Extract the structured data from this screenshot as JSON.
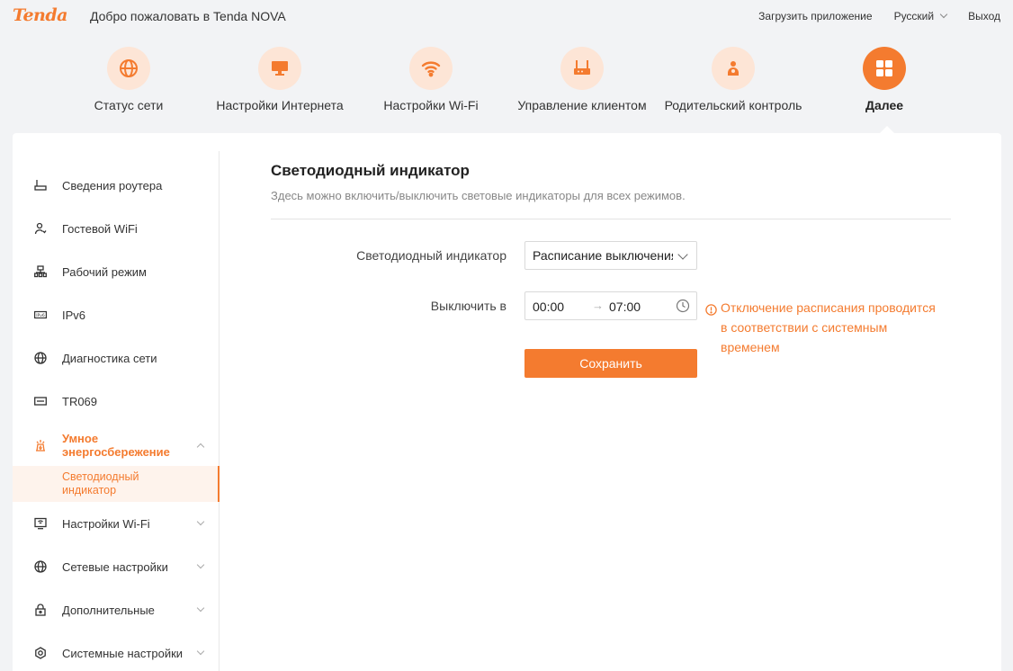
{
  "header": {
    "logo": "Tenda",
    "welcome": "Добро пожаловать в Tenda NOVA",
    "download_app": "Загрузить приложение",
    "language": "Русский",
    "logout": "Выход"
  },
  "nav": [
    {
      "label": "Статус сети",
      "icon": "globe-icon"
    },
    {
      "label": "Настройки Интернета",
      "icon": "monitor-icon"
    },
    {
      "label": "Настройки Wi-Fi",
      "icon": "wifi-icon"
    },
    {
      "label": "Управление клиентом",
      "icon": "router-icon"
    },
    {
      "label": "Родительский контроль",
      "icon": "parent-icon"
    },
    {
      "label": "Далее",
      "icon": "grid-icon",
      "active": true
    }
  ],
  "sidebar": {
    "items": [
      {
        "label": "Сведения роутера",
        "icon": "router-info-icon"
      },
      {
        "label": "Гостевой WiFi",
        "icon": "guest-icon"
      },
      {
        "label": "Рабочий режим",
        "icon": "topology-icon"
      },
      {
        "label": "IPv6",
        "icon": "ipv6-icon"
      },
      {
        "label": "Диагностика сети",
        "icon": "globe-icon"
      },
      {
        "label": "TR069",
        "icon": "tr069-icon"
      },
      {
        "label": "Умное энергосбережение",
        "icon": "energy-icon",
        "expanded": true
      },
      {
        "label": "Настройки Wi-Fi",
        "icon": "wifi-settings-icon"
      },
      {
        "label": "Сетевые настройки",
        "icon": "globe-icon"
      },
      {
        "label": "Дополнительные",
        "icon": "lock-icon"
      },
      {
        "label": "Системные настройки",
        "icon": "settings-icon"
      }
    ],
    "sub_item": "Светодиодный индикатор"
  },
  "content": {
    "title": "Светодиодный индикатор",
    "description": "Здесь можно включить/выключить световые индикаторы для всех режимов.",
    "led_label": "Светодиодный индикатор",
    "led_value": "Расписание выключения",
    "off_label": "Выключить в",
    "time_start": "00:00",
    "time_end": "07:00",
    "warning": "Отключение расписания проводится в соответствии с системным временем",
    "save": "Сохранить"
  },
  "colors": {
    "accent": "#f47b2f",
    "accent_light": "#fde5d6"
  }
}
